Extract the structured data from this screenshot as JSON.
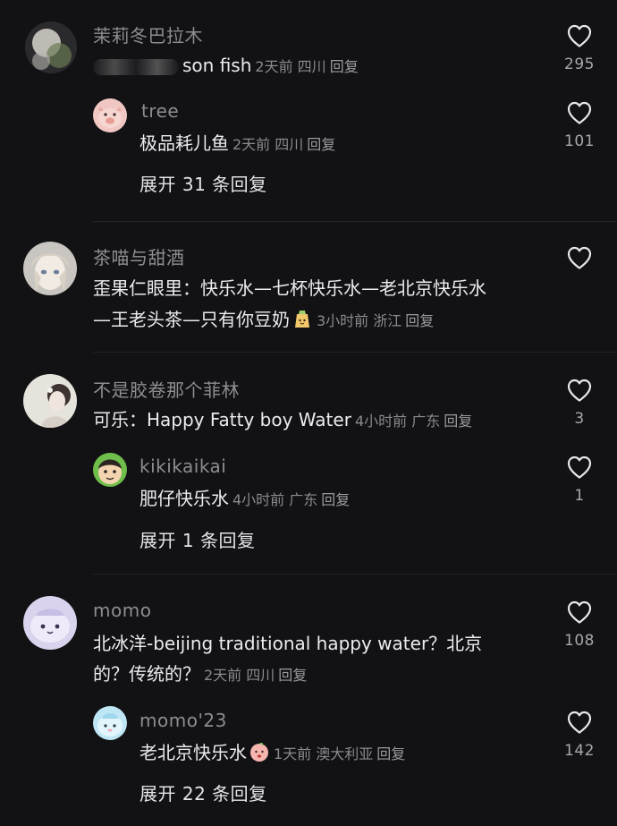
{
  "comments": [
    {
      "username": "茉莉冬巴拉木",
      "text": "son fish",
      "time": "2天前",
      "location": "四川",
      "reply_label": "回复",
      "likes": "295",
      "replies": [
        {
          "username": "tree",
          "text": "极品耗儿鱼",
          "time": "2天前",
          "location": "四川",
          "reply_label": "回复",
          "likes": "101"
        }
      ],
      "expand_label": "展开 31 条回复"
    },
    {
      "username": "茶喵与甜酒",
      "text_line1": "歪果仁眼里：快乐水—七杯快乐水—老北京快乐水",
      "text_line2": "—王老头茶—只有你豆奶",
      "time": "3小时前",
      "location": "浙江",
      "reply_label": "回复",
      "likes": ""
    },
    {
      "username": "不是胶卷那个菲林",
      "text": "可乐：Happy Fatty boy Water",
      "time": "4小时前",
      "location": "广东",
      "reply_label": "回复",
      "likes": "3",
      "replies": [
        {
          "username": "kikikaikai",
          "text": "肥仔快乐水",
          "time": "4小时前",
          "location": "广东",
          "reply_label": "回复",
          "likes": "1"
        }
      ],
      "expand_label": "展开 1 条回复"
    },
    {
      "username": "momo",
      "text_line1": "北冰洋-beijing traditional happy water？北京",
      "text_line2": "的？传统的？",
      "time": "2天前",
      "location": "四川",
      "reply_label": "回复",
      "likes": "108",
      "replies": [
        {
          "username": "momo'23",
          "text": "老北京快乐水",
          "time": "1天前",
          "location": "澳大利亚",
          "reply_label": "回复",
          "likes": "142"
        }
      ],
      "expand_label": "展开 22 条回复"
    }
  ],
  "icons": {
    "like": "heart-outline-icon"
  },
  "colors": {
    "background": "#121214",
    "username": "#8d8d92",
    "text": "#ececee",
    "meta": "#8a8a8f"
  }
}
